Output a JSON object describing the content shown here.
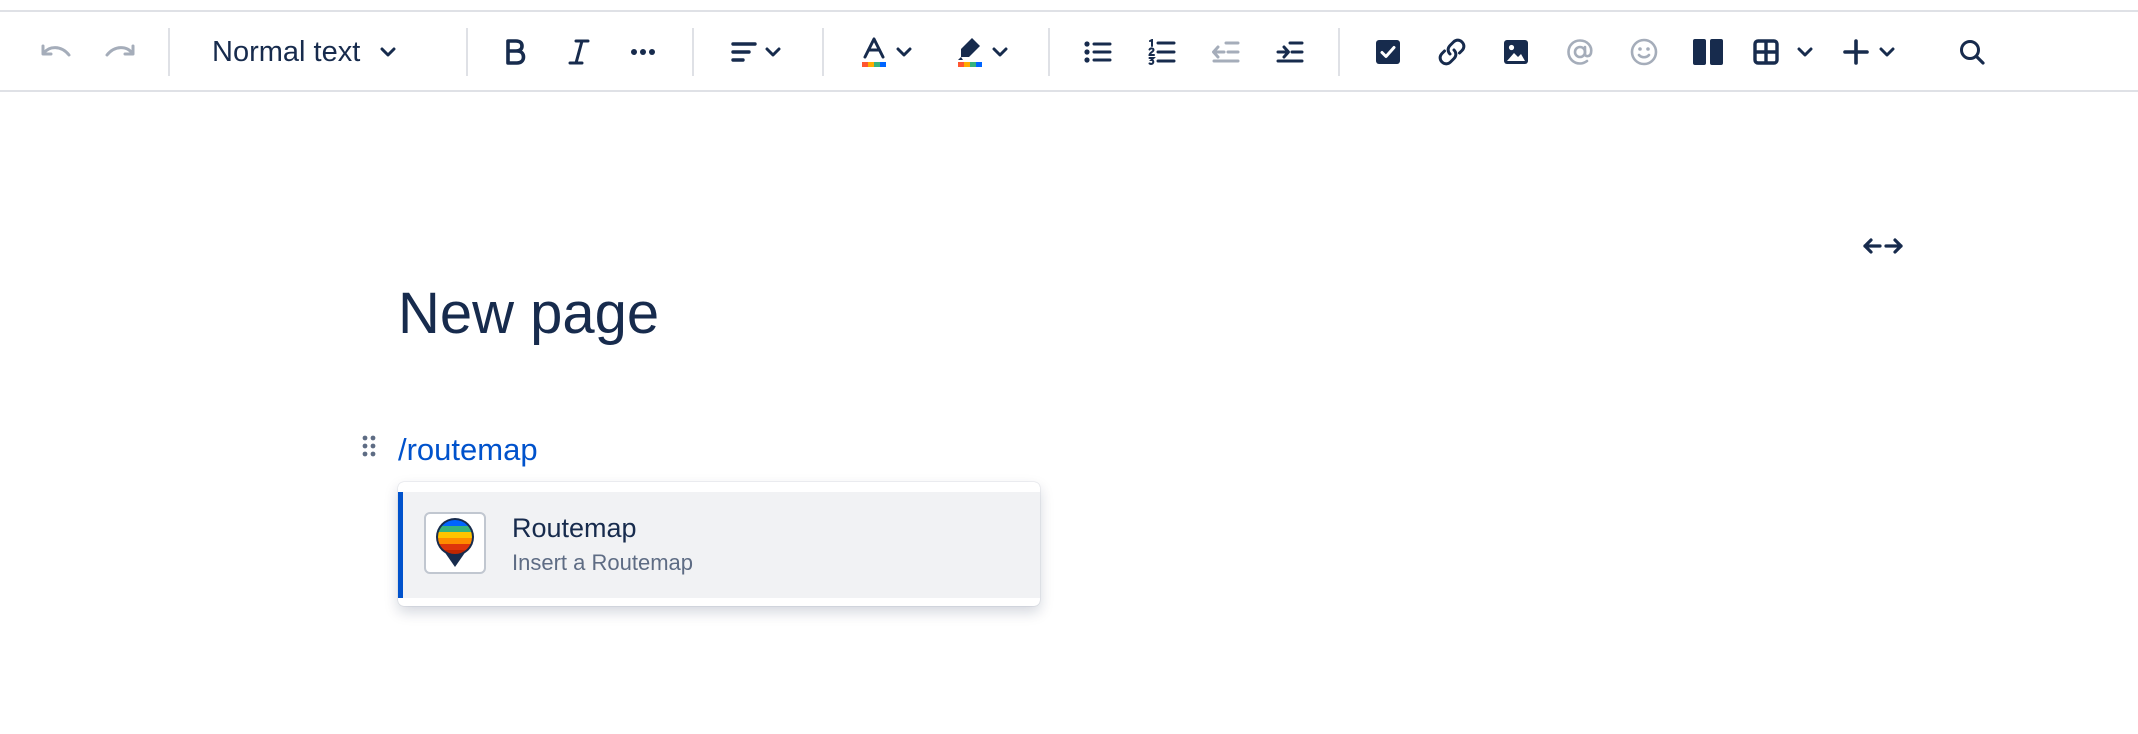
{
  "toolbar": {
    "text_style": "Normal text"
  },
  "editor": {
    "title": "New page",
    "slash_command": "/routemap"
  },
  "typeahead": {
    "items": [
      {
        "title": "Routemap",
        "description": "Insert a Routemap",
        "icon": "routemap-pin-icon"
      }
    ]
  },
  "colors": {
    "text": "#172b4d",
    "link": "#0052cc",
    "disabled": "#a5adba",
    "border": "#dfe1e6",
    "hover_bg": "#f1f2f4",
    "secondary_text": "#5e6c84"
  }
}
